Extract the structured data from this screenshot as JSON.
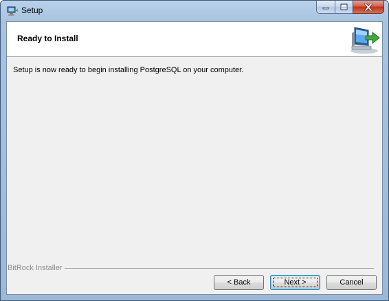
{
  "window": {
    "title": "Setup",
    "app_icon": "installer-icon",
    "caption_buttons": [
      "minimize-icon",
      "maximize-icon",
      "close-icon"
    ]
  },
  "header": {
    "title": "Ready to Install",
    "logo": "computer-install-arrow-icon"
  },
  "main": {
    "message": "Setup is now ready to begin installing PostgreSQL on your computer."
  },
  "footer": {
    "brand": "BitRock Installer",
    "back_label": "< Back",
    "next_label": "Next >",
    "cancel_label": "Cancel"
  }
}
